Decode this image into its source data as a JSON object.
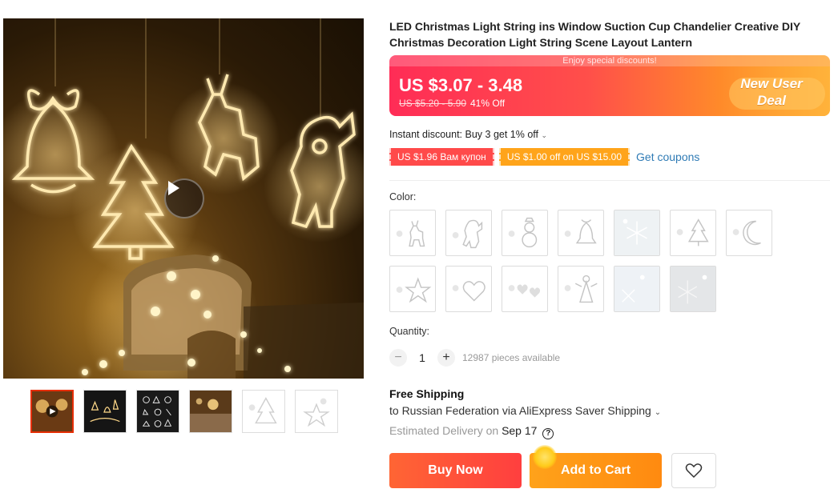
{
  "gallery": {
    "main_image_alt": "",
    "play_icon": "play-icon",
    "thumbnails": [
      "thumb-1",
      "thumb-2",
      "thumb-3",
      "thumb-4",
      "thumb-5",
      "thumb-6"
    ],
    "active_thumbnail": 0
  },
  "product": {
    "title": "LED Christmas Light String ins Window Suction Cup Chandelier Creative DIY Christmas Decoration Light String Scene Layout Lantern"
  },
  "price": {
    "top_strip": "Enjoy special discounts!",
    "current": "US $3.07 - 3.48",
    "original": "US $5.20 - 5.90",
    "discount": "41% Off",
    "badge_line1": "New User",
    "badge_line2": "Deal"
  },
  "promos": {
    "instant_discount": "Instant discount: Buy 3 get 1% off",
    "coupon_1": "US $1.96 Вам купон",
    "coupon_2": "US $1.00 off on US $15.00",
    "get_coupons": "Get coupons"
  },
  "color": {
    "label": "Color:",
    "options": [
      "reindeer",
      "santa",
      "snowman",
      "bell",
      "snowflake",
      "tree",
      "moon",
      "star",
      "heart",
      "hearts",
      "angel",
      "snowflake-2",
      "snowflake-3"
    ]
  },
  "quantity": {
    "label": "Quantity:",
    "value": "1",
    "minus": "−",
    "plus": "+",
    "available": "12987 pieces available"
  },
  "shipping": {
    "title": "Free Shipping",
    "to": "to Russian Federation via AliExpress Saver Shipping",
    "estimated_label": "Estimated Delivery on",
    "estimated_date": "Sep 17",
    "help": "?"
  },
  "actions": {
    "buy_now": "Buy Now",
    "add_to_cart": "Add to Cart",
    "wishlist_icon": "heart-icon"
  },
  "colors": {
    "accent_red": "#ff4a4a",
    "accent_orange": "#ffa21a",
    "link_blue": "#2f7bb5"
  }
}
